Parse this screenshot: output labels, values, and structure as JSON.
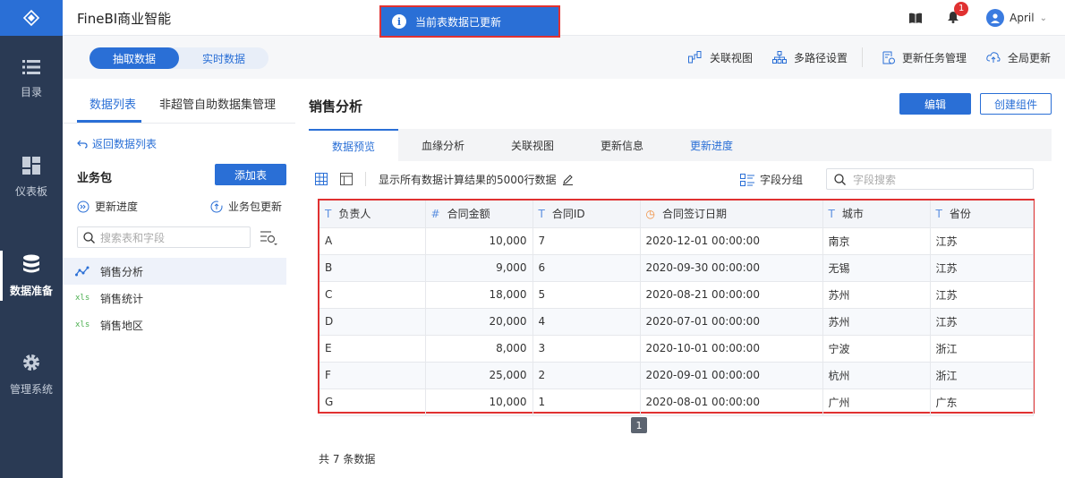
{
  "app": {
    "title": "FineBI商业智能"
  },
  "toast": {
    "text": "当前表数据已更新"
  },
  "user": {
    "name": "April",
    "notifications": "1"
  },
  "nav": {
    "items": [
      {
        "label": "目录",
        "icon": "list-icon"
      },
      {
        "label": "仪表板",
        "icon": "dashboard-icon"
      },
      {
        "label": "数据准备",
        "icon": "database-icon"
      },
      {
        "label": "管理系统",
        "icon": "gear-icon"
      }
    ]
  },
  "mode_switch": {
    "extract": "抽取数据",
    "realtime": "实时数据"
  },
  "toolbar": {
    "relation_view": "关联视图",
    "multi_path": "多路径设置",
    "update_task": "更新任务管理",
    "global_update": "全局更新"
  },
  "left_panel": {
    "tabs": [
      "数据列表",
      "非超管自助数据集管理"
    ],
    "back": "返回数据列表",
    "package_title": "业务包",
    "add_table": "添加表",
    "update_progress": "更新进度",
    "package_update": "业务包更新",
    "search_placeholder": "搜索表和字段",
    "tables": [
      {
        "name": "销售分析",
        "type": "analysis"
      },
      {
        "name": "销售统计",
        "type": "xls"
      },
      {
        "name": "销售地区",
        "type": "xls"
      }
    ]
  },
  "main": {
    "title": "销售分析",
    "edit": "编辑",
    "create_component": "创建组件",
    "tabs": [
      "数据预览",
      "血缘分析",
      "关联视图",
      "更新信息",
      "更新进度"
    ],
    "preview_desc": "显示所有数据计算结果的5000行数据",
    "field_group": "字段分组",
    "field_search_placeholder": "字段搜索",
    "columns": [
      {
        "name": "负责人",
        "type": "T"
      },
      {
        "name": "合同金额",
        "type": "#"
      },
      {
        "name": "合同ID",
        "type": "T"
      },
      {
        "name": "合同签订日期",
        "type": "date"
      },
      {
        "name": "城市",
        "type": "T"
      },
      {
        "name": "省份",
        "type": "T"
      }
    ],
    "rows": [
      [
        "A",
        "10,000",
        "7",
        "2020-12-01 00:00:00",
        "南京",
        "江苏"
      ],
      [
        "B",
        "9,000",
        "6",
        "2020-09-30 00:00:00",
        "无锡",
        "江苏"
      ],
      [
        "C",
        "18,000",
        "5",
        "2020-08-21 00:00:00",
        "苏州",
        "江苏"
      ],
      [
        "D",
        "20,000",
        "4",
        "2020-07-01 00:00:00",
        "苏州",
        "江苏"
      ],
      [
        "E",
        "8,000",
        "3",
        "2020-10-01 00:00:00",
        "宁波",
        "浙江"
      ],
      [
        "F",
        "25,000",
        "2",
        "2020-09-01 00:00:00",
        "杭州",
        "浙江"
      ],
      [
        "G",
        "10,000",
        "1",
        "2020-08-01 00:00:00",
        "广州",
        "广东"
      ]
    ],
    "page": "1",
    "total_prefix": "共",
    "total_count": "7",
    "total_suffix": "条数据"
  }
}
